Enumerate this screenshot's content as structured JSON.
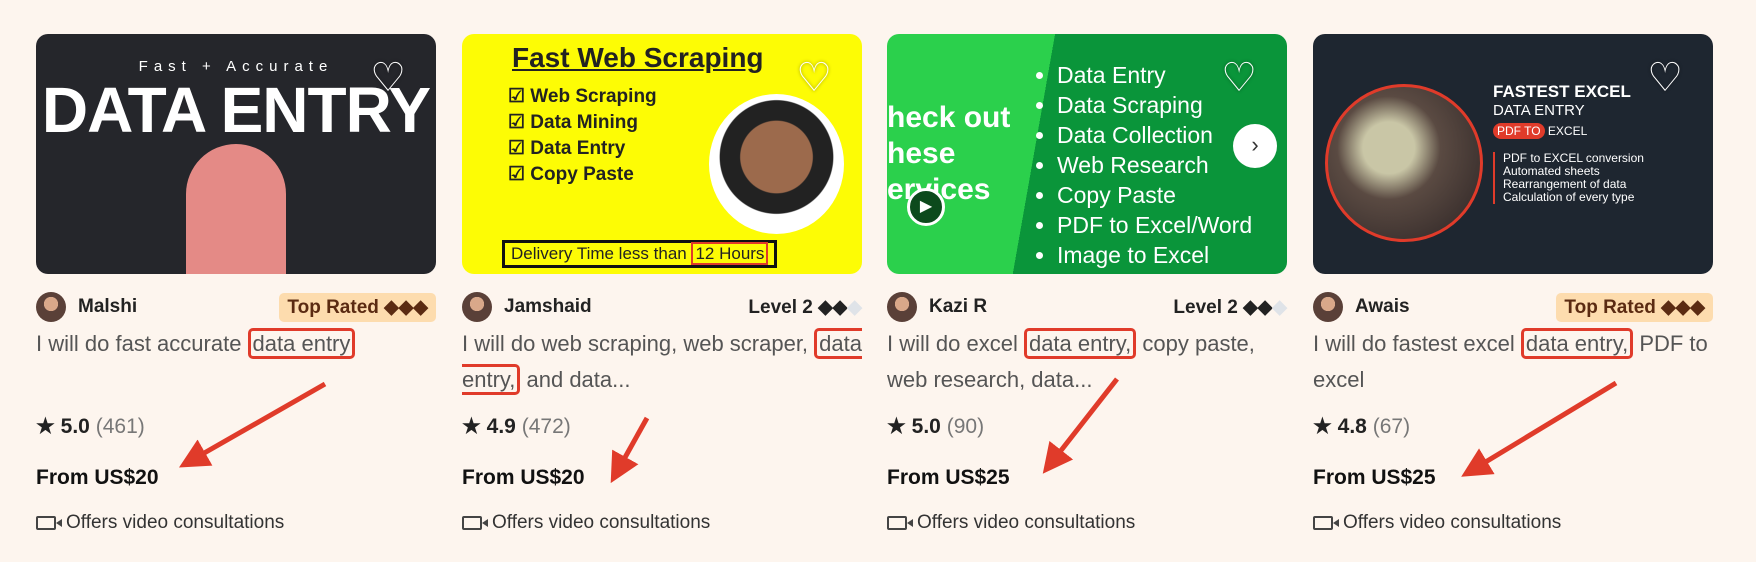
{
  "accent_color": "#e03b2a",
  "gigs": [
    {
      "seller": "Malshi",
      "level": "Top Rated",
      "level_diamonds": "◆◆◆",
      "level_diamonds_off": "",
      "title_pre": "I will do fast accurate ",
      "title_hl": "data entry",
      "title_post": "",
      "rating": "5.0",
      "reviews": "(461)",
      "price": "From US$20",
      "video": "Offers video consultations",
      "thumb": {
        "sub": "Fast + Accurate",
        "big": "DATA ENTRY"
      }
    },
    {
      "seller": "Jamshaid",
      "level": "Level 2",
      "level_diamonds": "◆◆",
      "level_diamonds_off": "◆",
      "title_pre": "I will do web scraping, web scraper, ",
      "title_hl": "data entry,",
      "title_post": " and data...",
      "rating": "4.9",
      "reviews": "(472)",
      "price": "From US$20",
      "video": "Offers video consultations",
      "thumb": {
        "heading": "Fast Web Scraping",
        "items": [
          "☑ Web Scraping",
          "☑ Data Mining",
          "☑ Data Entry",
          "☑ Copy Paste"
        ],
        "delivery": "Delivery Time less than ",
        "delivery_hl": "12 Hours"
      }
    },
    {
      "seller": "Kazi R",
      "level": "Level 2",
      "level_diamonds": "◆◆",
      "level_diamonds_off": "◆",
      "title_pre": "I will do excel ",
      "title_hl": "data entry,",
      "title_post": " copy paste, web research, data...",
      "rating": "5.0",
      "reviews": "(90)",
      "price": "From US$25",
      "video": "Offers video consultations",
      "thumb": {
        "left": "heck out\nhese\nervices",
        "items": [
          "Data Entry",
          "Data Scraping",
          "Data Collection",
          "Web Research",
          "Copy Paste",
          "PDF to Excel/Word",
          "Image to Excel"
        ]
      }
    },
    {
      "seller": "Awais",
      "level": "Top Rated",
      "level_diamonds": "◆◆◆",
      "level_diamonds_off": "",
      "title_pre": "I will do fastest excel ",
      "title_hl": "data entry,",
      "title_post": " PDF to excel",
      "rating": "4.8",
      "reviews": "(67)",
      "price": "From US$25",
      "video": "Offers video consultations",
      "thumb": {
        "h1": "FASTEST EXCEL",
        "h2": "DATA ENTRY",
        "h3a": "PDF TO",
        "h3b": " EXCEL",
        "items": [
          "PDF to EXCEL conversion",
          "Automated sheets",
          "Rearrangement of data",
          "Calculation of every type"
        ]
      }
    }
  ]
}
